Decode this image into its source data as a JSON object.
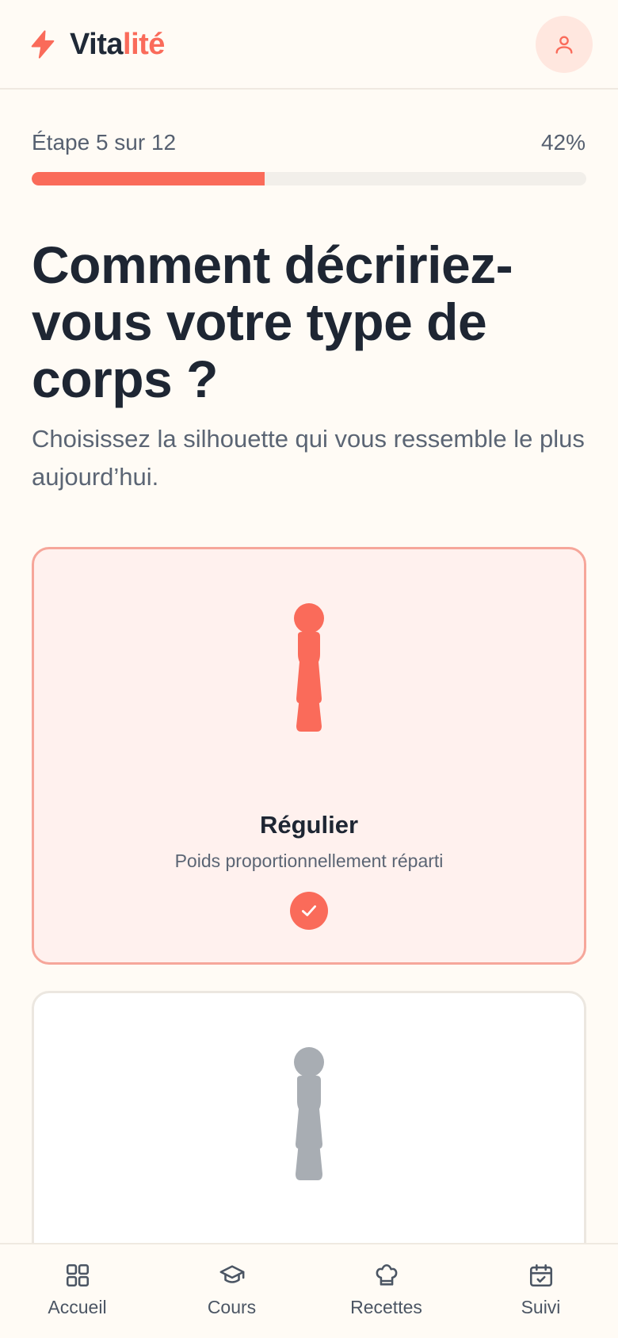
{
  "header": {
    "logo_text_a": "Vita",
    "logo_text_b": "lité",
    "logo_icon": "bolt-icon",
    "profile_icon": "user-icon"
  },
  "progress": {
    "label": "Étape 5 sur 12",
    "percent_label": "42%",
    "fraction": 0.42
  },
  "question": {
    "title": "Comment décririez-vous votre type de corps ?",
    "subtitle": "Choisissez la silhouette qui vous ressemble le plus aujourd’hui."
  },
  "options": [
    {
      "title": "Régulier",
      "description": "Poids proportionnellement réparti",
      "selected": true,
      "color": "#fa6b5a"
    },
    {
      "selected": false,
      "color": "#a8adb3"
    }
  ],
  "bottom_nav": [
    {
      "label": "Accueil",
      "icon": "grid-icon"
    },
    {
      "label": "Cours",
      "icon": "graduation-cap-icon"
    },
    {
      "label": "Recettes",
      "icon": "chef-hat-icon"
    },
    {
      "label": "Suivi",
      "icon": "calendar-check-icon"
    }
  ],
  "colors": {
    "accent": "#fa6b5a",
    "background": "#fffbf5",
    "text": "#1e2633",
    "muted": "#5b6574"
  }
}
